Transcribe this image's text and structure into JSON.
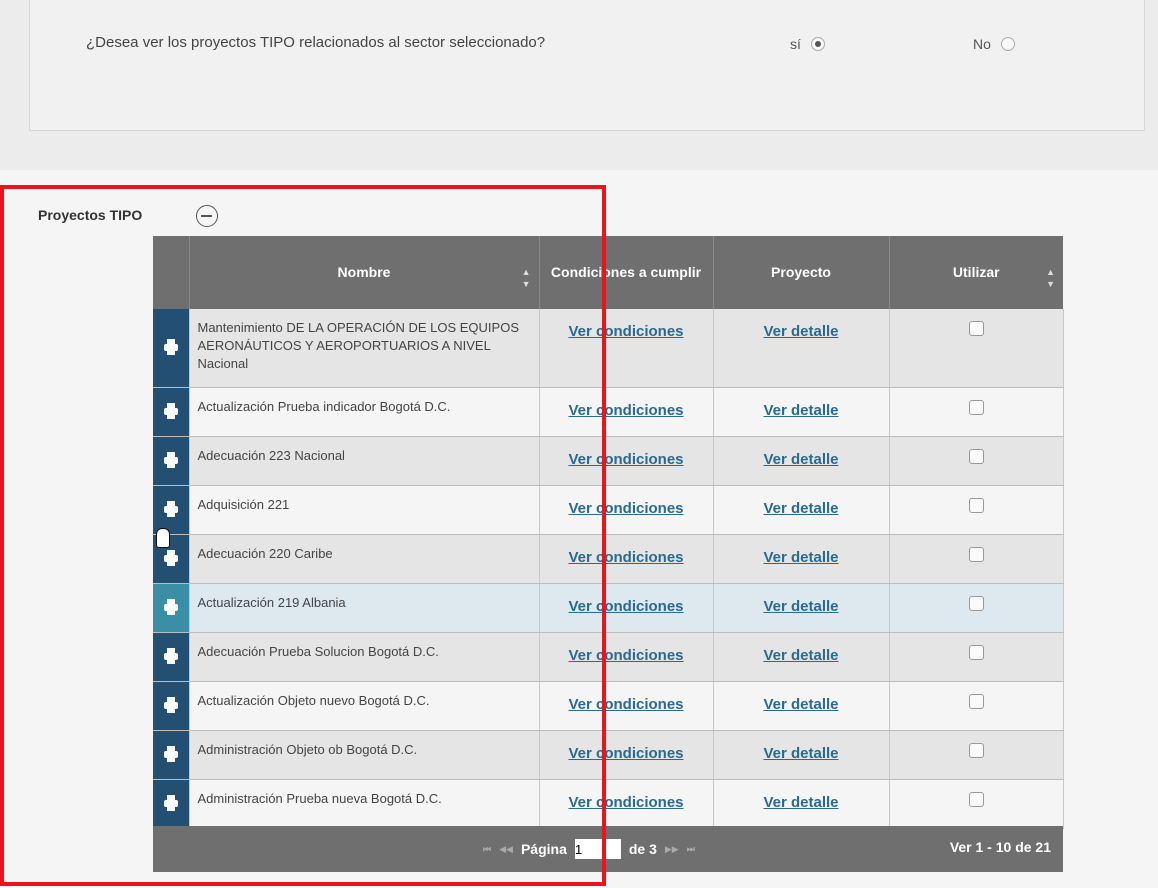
{
  "question": {
    "text": "¿Desea ver los proyectos TIPO relacionados al sector seleccionado?",
    "options": [
      {
        "label": "sí",
        "checked": true
      },
      {
        "label": "No",
        "checked": false
      }
    ]
  },
  "section": {
    "title": "Proyectos TIPO",
    "collapse_icon": "minus-circle-icon"
  },
  "table": {
    "headers": {
      "name": "Nombre",
      "conditions": "Condiciones a cumplir",
      "project": "Proyecto",
      "use": "Utilizar"
    },
    "link_conditions": "Ver condiciones",
    "link_detail": "Ver detalle",
    "row_icon": "printer-icon",
    "rows": [
      {
        "name": "Mantenimiento DE LA  OPERACIÓN DE LOS EQUIPOS AERONÁUTICOS Y AEROPORTUARIOS A NIVEL  Nacional"
      },
      {
        "name": "Actualización Prueba indicador  Bogotá D.C."
      },
      {
        "name": "Adecuación 223  Nacional"
      },
      {
        "name": "Adquisición 221"
      },
      {
        "name": "Adecuación 220  Caribe"
      },
      {
        "name": "Actualización 219  Albania"
      },
      {
        "name": "Adecuación Prueba Solucion  Bogotá D.C."
      },
      {
        "name": "Actualización Objeto nuevo  Bogotá D.C."
      },
      {
        "name": "Administración Objeto ob  Bogotá D.C."
      },
      {
        "name": "Administración Prueba nueva  Bogotá D.C."
      }
    ]
  },
  "pager": {
    "page_label": "Página",
    "page_value": "1",
    "of_label": "de 3",
    "summary": "Ver 1 - 10 de 21"
  },
  "colors": {
    "header_bg": "#6f6f6f",
    "row_icon_bg": "#234f72",
    "link": "#2a6a8e",
    "highlight_frame": "#e8161c"
  }
}
